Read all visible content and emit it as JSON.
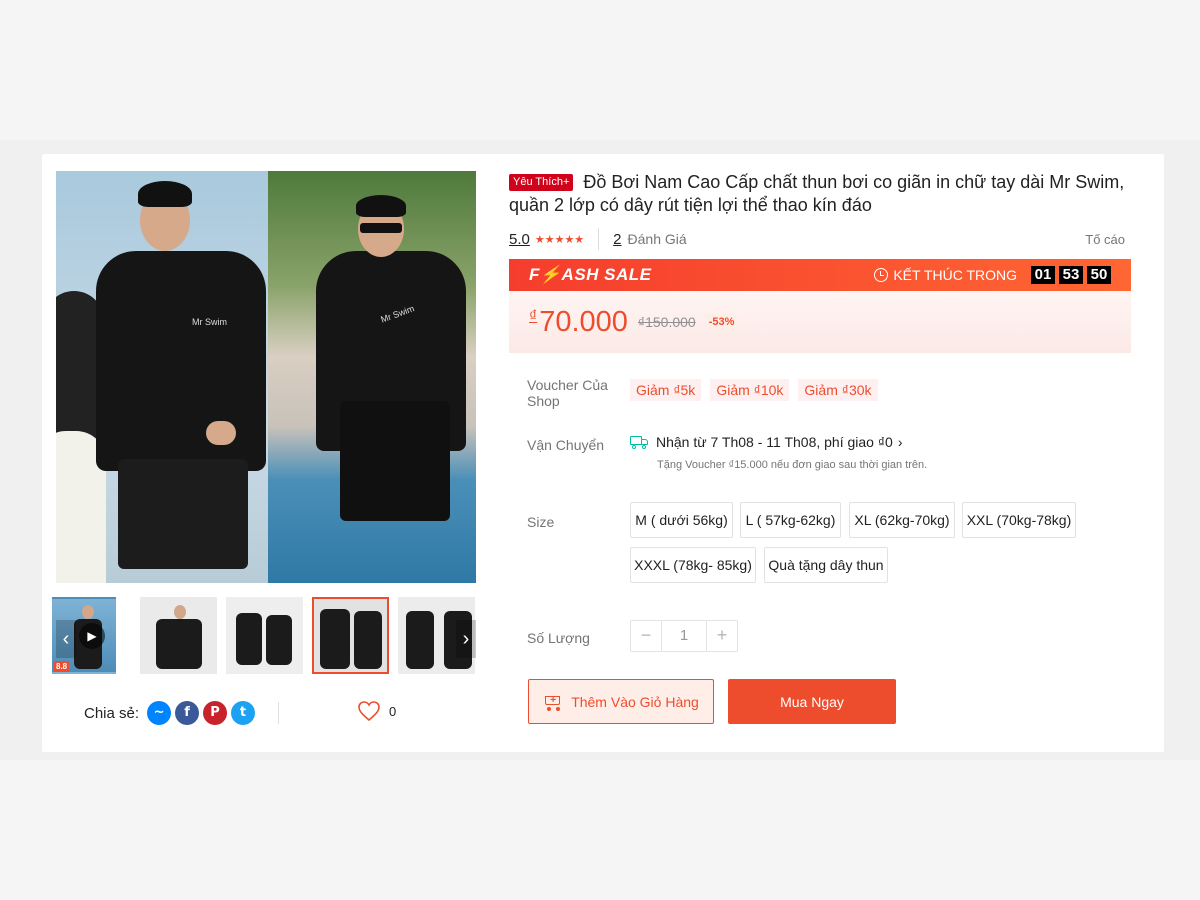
{
  "product": {
    "preferred_badge": "Yêu Thích+",
    "title": "Đồ Bơi Nam Cao Cấp chất thun bơi co giãn in chữ tay dài Mr Swim, quần 2 lớp có dây rút tiện lợi thể thao kín đáo",
    "rating": "5.0",
    "stars": "★★★★★",
    "review_count": "2",
    "review_label": "Đánh Giá",
    "report_label": "Tố cáo",
    "image_brand_text": "Mr Swim"
  },
  "flash_sale": {
    "title": "F⚡ASH SALE",
    "ends_label": "KẾT THÚC TRONG",
    "hours": "01",
    "minutes": "53",
    "seconds": "50"
  },
  "price": {
    "currency": "₫",
    "current": "70.000",
    "original": "₫150.000",
    "discount": "-53%"
  },
  "vouchers": {
    "label": "Voucher Của Shop",
    "items": [
      "Giảm ₫5k",
      "Giảm ₫10k",
      "Giảm ₫30k"
    ]
  },
  "shipping": {
    "label": "Vận Chuyển",
    "main": "Nhận từ 7 Th08 - 11 Th08, phí giao ₫0",
    "sub": "Tặng Voucher ₫15.000 nếu đơn giao sau thời gian trên."
  },
  "size": {
    "label": "Size",
    "options": [
      "M ( dưới 56kg)",
      "L ( 57kg-62kg)",
      "XL (62kg-70kg)",
      "XXL (70kg-78kg)",
      "XXXL (78kg- 85kg)",
      "Quà tặng dây thun"
    ]
  },
  "quantity": {
    "label": "Số Lượng",
    "minus": "−",
    "value": "1",
    "plus": "+"
  },
  "actions": {
    "add_to_cart": "Thêm Vào Giỏ Hàng",
    "buy_now": "Mua Ngay"
  },
  "share": {
    "label": "Chia sẻ:",
    "like_count": "0"
  },
  "gallery": {
    "video_badge": "8.8",
    "prev": "‹",
    "next": "›"
  },
  "colors": {
    "accent": "#ee4d2d",
    "preferred": "#d0011b",
    "messenger": "#0084ff",
    "facebook": "#3b5998",
    "pinterest": "#c8232c",
    "twitter": "#1da1f2"
  }
}
